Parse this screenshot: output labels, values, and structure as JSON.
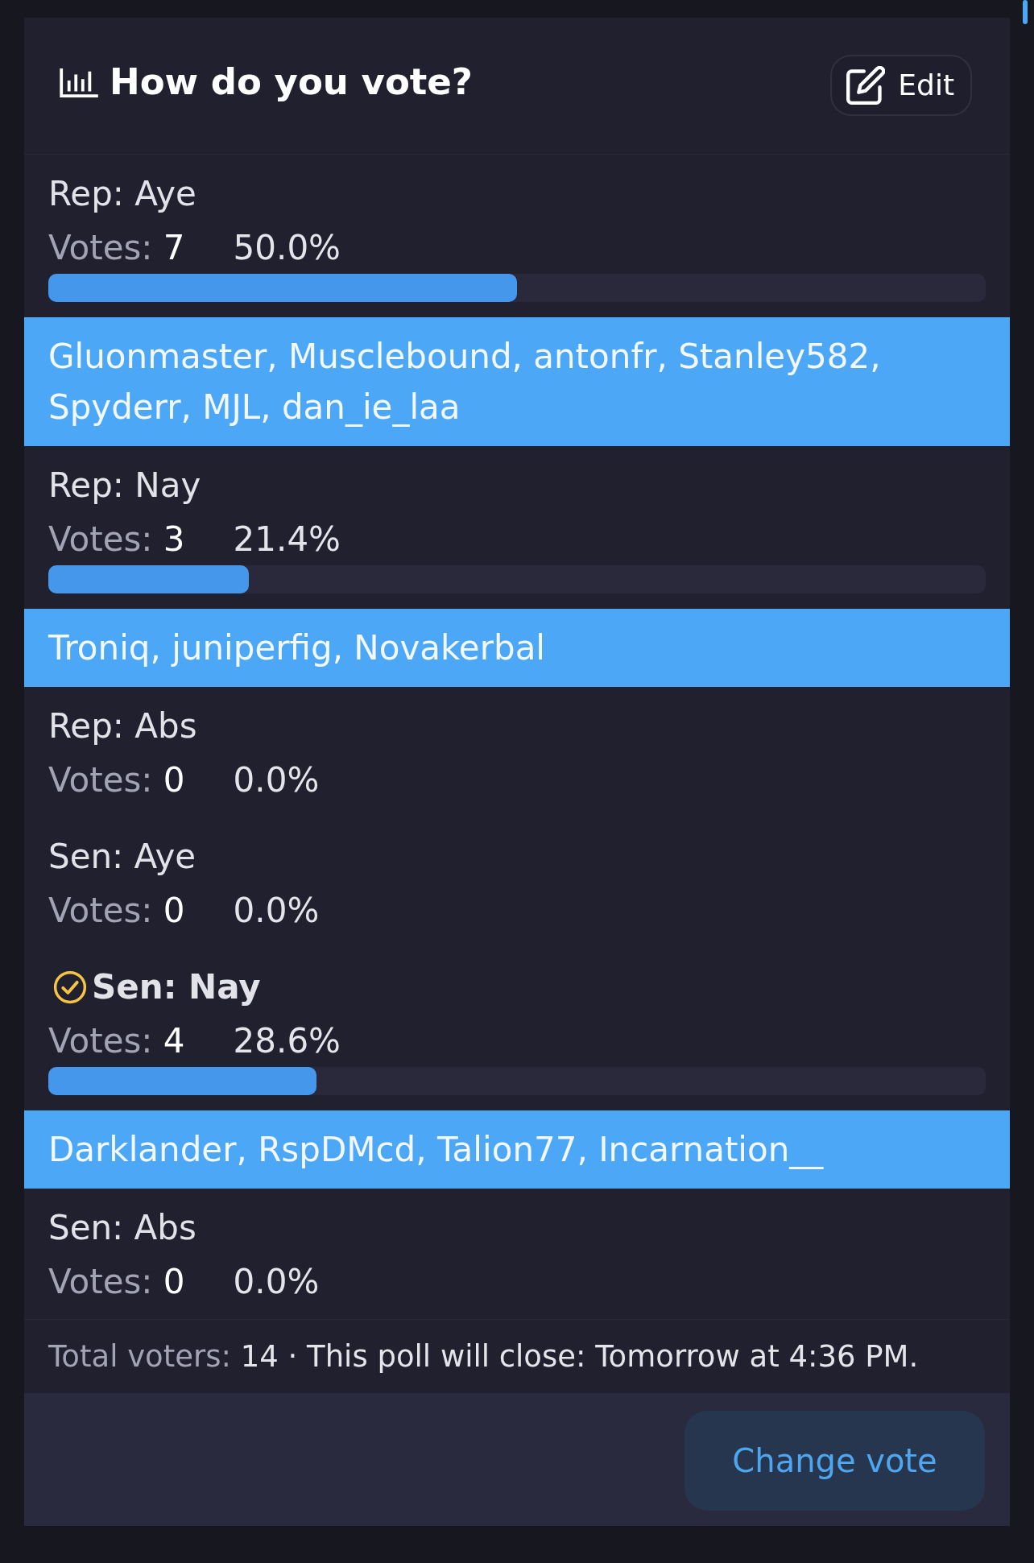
{
  "poll": {
    "title": "How do you vote?",
    "edit_button": "Edit",
    "options": [
      {
        "label": "Rep: Aye",
        "selected": false,
        "votes_label": "Votes:",
        "votes": "7",
        "percent": "50.0%",
        "level": 0.5,
        "voters": "Gluonmaster, Musclebound, antonfr, Stanley582, Spyderr, MJL, dan_ie_laa"
      },
      {
        "label": "Rep: Nay",
        "selected": false,
        "votes_label": "Votes:",
        "votes": "3",
        "percent": "21.4%",
        "level": 0.214,
        "voters": "Troniq, juniperfig, Novakerbal"
      },
      {
        "label": "Rep: Abs",
        "selected": false,
        "votes_label": "Votes:",
        "votes": "0",
        "percent": "0.0%"
      },
      {
        "label": "Sen: Aye",
        "selected": false,
        "votes_label": "Votes:",
        "votes": "0",
        "percent": "0.0%"
      },
      {
        "label": "Sen: Nay",
        "selected": true,
        "votes_label": "Votes:",
        "votes": "4",
        "percent": "28.6%",
        "level": 0.286,
        "voters": "Darklander, RspDMcd, Talion77, Incarnation__"
      },
      {
        "label": "Sen: Abs",
        "selected": false,
        "votes_label": "Votes:",
        "votes": "0",
        "percent": "0.0%"
      }
    ],
    "footer": {
      "voters_label": "Total voters:",
      "voters": "14",
      "close_text": "· This poll will close: Tomorrow at 4:36 PM."
    },
    "change_vote_button": "Change vote"
  }
}
